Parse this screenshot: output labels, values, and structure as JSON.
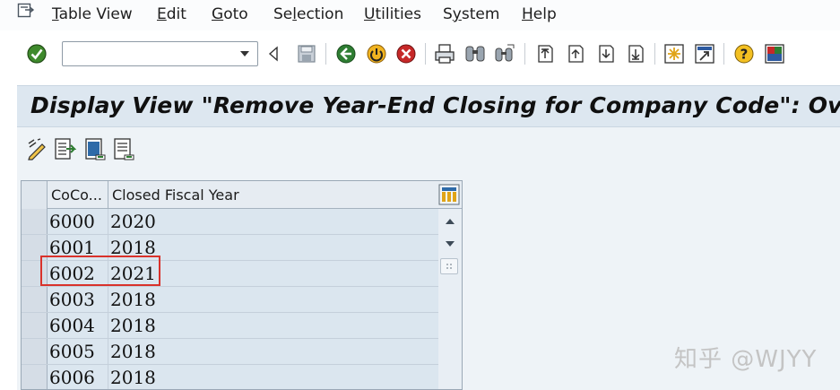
{
  "menu": {
    "items": [
      {
        "mnemonic": "T",
        "rest": "able View"
      },
      {
        "mnemonic": "E",
        "rest": "dit"
      },
      {
        "mnemonic": "G",
        "rest": "oto"
      },
      {
        "pre": "Se",
        "mnemonic": "l",
        "rest": "ection"
      },
      {
        "mnemonic": "U",
        "rest": "tilities"
      },
      {
        "pre": "S",
        "mnemonic": "y",
        "rest": "stem"
      },
      {
        "mnemonic": "H",
        "rest": "elp"
      }
    ]
  },
  "toolbar": {
    "command_value": "",
    "icons": [
      "enter-checkmark-icon",
      "command-dropdown-icon",
      "collapse-triangle-icon",
      "save-icon",
      "back-icon",
      "exit-icon",
      "cancel-icon",
      "print-icon",
      "find-icon",
      "find-next-icon",
      "first-page-icon",
      "previous-page-icon",
      "next-page-icon",
      "last-page-icon",
      "create-session-icon",
      "shortcut-icon",
      "help-icon",
      "customize-layout-icon"
    ]
  },
  "title": "Display View \"Remove Year-End Closing for Company Code\": Overview",
  "app_toolbar": {
    "icons": [
      "display-change-icon",
      "details-icon",
      "select-all-icon",
      "deselect-all-icon"
    ]
  },
  "table": {
    "columns": [
      "CoCo...",
      "Closed Fiscal Year"
    ],
    "rows": [
      {
        "coco": "6000",
        "year": "2020"
      },
      {
        "coco": "6001",
        "year": "2018"
      },
      {
        "coco": "6002",
        "year": "2021"
      },
      {
        "coco": "6003",
        "year": "2018"
      },
      {
        "coco": "6004",
        "year": "2018"
      },
      {
        "coco": "6005",
        "year": "2018"
      },
      {
        "coco": "6006",
        "year": "2018"
      }
    ]
  },
  "watermark": "知乎 @WJYY",
  "colors": {
    "highlight": "#d9322b",
    "title_bg": "#dde7f0",
    "cell_bg": "#dbe6ef"
  }
}
